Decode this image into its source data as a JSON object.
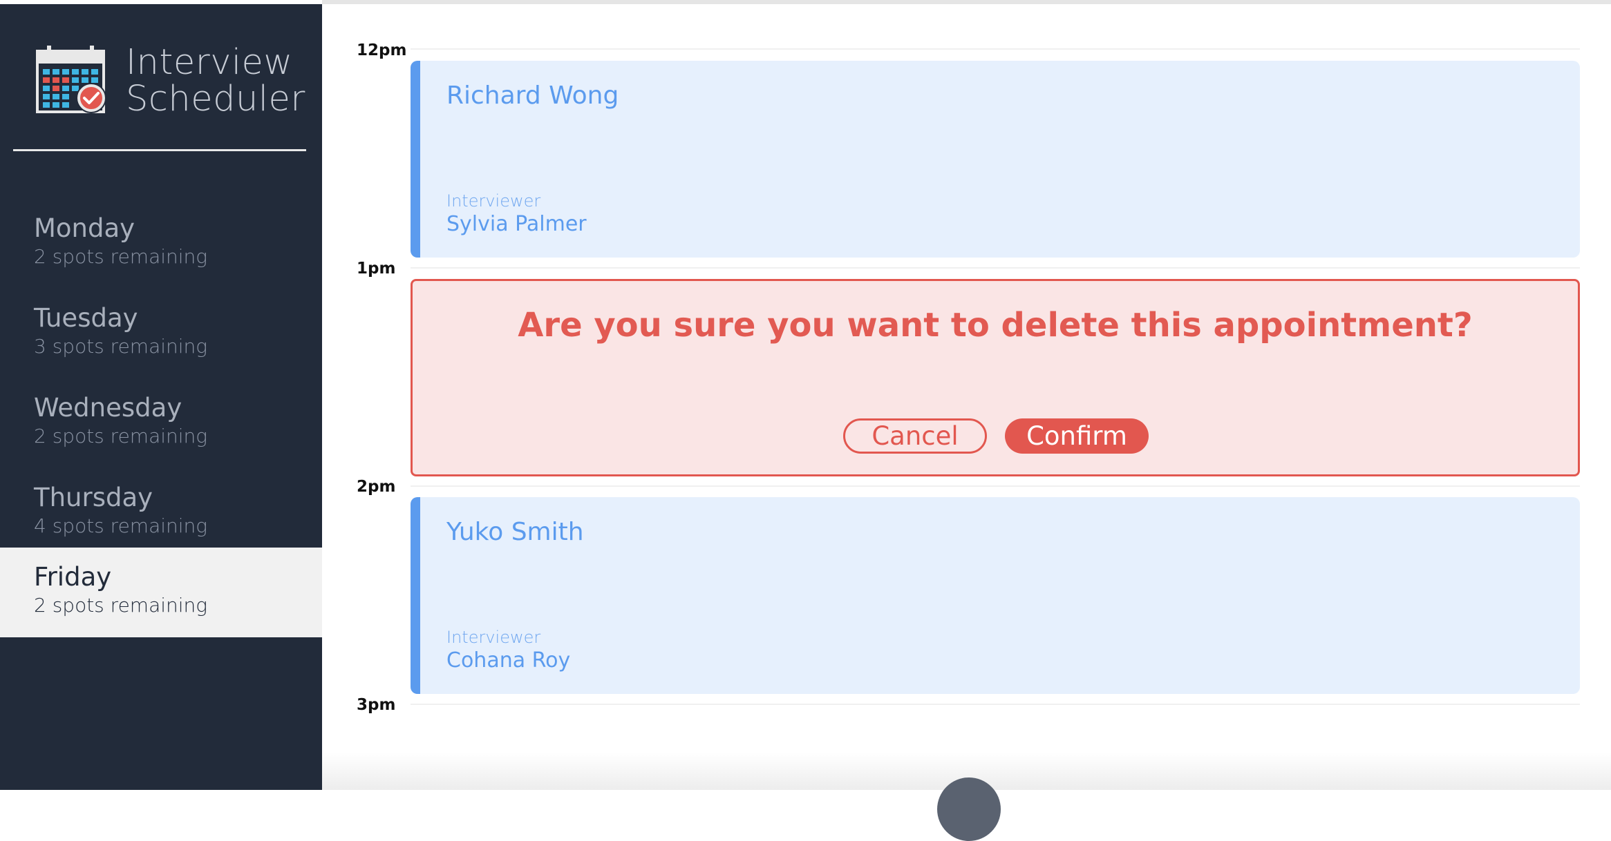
{
  "app": {
    "title_line1": "Interview",
    "title_line2": "Scheduler",
    "logo_icon": "calendar-check-icon"
  },
  "days": [
    {
      "name": "Monday",
      "spots": "2 spots remaining",
      "selected": false
    },
    {
      "name": "Tuesday",
      "spots": "3 spots remaining",
      "selected": false
    },
    {
      "name": "Wednesday",
      "spots": "2 spots remaining",
      "selected": false
    },
    {
      "name": "Thursday",
      "spots": "4 spots remaining",
      "selected": false
    },
    {
      "name": "Friday",
      "spots": "2 spots remaining",
      "selected": true
    }
  ],
  "times": [
    "12pm",
    "1pm",
    "2pm",
    "3pm"
  ],
  "appointments": [
    {
      "student": "Richard Wong",
      "interviewer_label": "Interviewer",
      "interviewer": "Sylvia Palmer"
    },
    {
      "student": "Yuko Smith",
      "interviewer_label": "Interviewer",
      "interviewer": "Cohana Roy"
    }
  ],
  "confirm": {
    "message": "Are you sure you want to delete this appointment?",
    "cancel_label": "Cancel",
    "confirm_label": "Confirm"
  },
  "colors": {
    "sidebar_bg": "#222b3a",
    "accent_blue": "#5b9bee",
    "danger_red": "#e2574f"
  }
}
